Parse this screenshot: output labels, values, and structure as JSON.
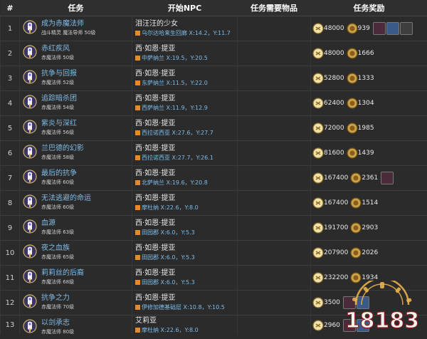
{
  "header": {
    "num": "#",
    "quest": "任务",
    "npc": "开始NPC",
    "items": "任务需要物品",
    "rewards": "任务奖励"
  },
  "rows": [
    {
      "n": "1",
      "name": "成为赤魔法师",
      "sub": "战斗精灵 魔法导师 50级",
      "npc": "泪汪汪的少女",
      "loc": "乌尔达哈来生回廊 X:14.2，Y:11.7",
      "gil": "48000",
      "seals": "939",
      "items": 3
    },
    {
      "n": "2",
      "name": "赤红疾风",
      "sub": "赤魔法师 50级",
      "npc": "西·如恩·提亚",
      "loc": "中萨纳兰 X:19.5，Y:20.5",
      "gil": "48000",
      "seals": "1666",
      "items": 0
    },
    {
      "n": "3",
      "name": "抗争与回报",
      "sub": "赤魔法师 52级",
      "npc": "西·如恩·提亚",
      "loc": "东萨纳兰 X:11.5，Y:22.0",
      "gil": "52800",
      "seals": "1333",
      "items": 0
    },
    {
      "n": "4",
      "name": "追踪暗杀团",
      "sub": "赤魔法师 54级",
      "npc": "西·如恩·提亚",
      "loc": "西萨纳兰 X:11.9，Y:12.9",
      "gil": "62400",
      "seals": "1304",
      "items": 0
    },
    {
      "n": "5",
      "name": "紫炎与深红",
      "sub": "赤魔法师 56级",
      "npc": "西·如恩·提亚",
      "loc": "西拉诺西亚 X:27.6，Y:27.7",
      "gil": "72000",
      "seals": "1985",
      "items": 0
    },
    {
      "n": "6",
      "name": "兰巴德的幻影",
      "sub": "赤魔法师 58级",
      "npc": "西·如恩·提亚",
      "loc": "西拉诺西亚 X:27.7，Y:26.1",
      "gil": "81600",
      "seals": "1439",
      "items": 0
    },
    {
      "n": "7",
      "name": "最后的抗争",
      "sub": "赤魔法师 60级",
      "npc": "西·如恩·提亚",
      "loc": "北萨纳兰 X:19.6，Y:20.8",
      "gil": "167400",
      "seals": "2361",
      "items": 1
    },
    {
      "n": "8",
      "name": "无法逃避的命运",
      "sub": "赤魔法师 60级",
      "npc": "西·如恩·提亚",
      "loc": "摩杜纳 X:22.6，Y:8.0",
      "gil": "167400",
      "seals": "1514",
      "items": 0
    },
    {
      "n": "9",
      "name": "血源",
      "sub": "赤魔法师 63级",
      "npc": "西·如恩·提亚",
      "loc": "田园郡 X:6.0，Y:5.3",
      "gil": "191700",
      "seals": "2903",
      "items": 0
    },
    {
      "n": "10",
      "name": "夜之血族",
      "sub": "赤魔法师 65级",
      "npc": "西·如恩·提亚",
      "loc": "田园郡 X:6.0，Y:5.3",
      "gil": "207900",
      "seals": "2026",
      "items": 0
    },
    {
      "n": "11",
      "name": "莉莉丝的后裔",
      "sub": "赤魔法师 68级",
      "npc": "西·如恩·提亚",
      "loc": "田园郡 X:6.0，Y:5.3",
      "gil": "232200",
      "seals": "1934",
      "items": 0
    },
    {
      "n": "12",
      "name": "抗争之力",
      "sub": "赤魔法师 70级",
      "npc": "西·如恩·提亚",
      "loc": "伊修加德基础层 X:10.8，Y:10.5",
      "gil": "3500",
      "seals": "",
      "items": 2
    },
    {
      "n": "13",
      "name": "以剑承志",
      "sub": "赤魔法师 80级",
      "npc": "艾莉亚",
      "loc": "摩杜纳 X:22.6，Y:8.0",
      "gil": "2960",
      "seals": "",
      "items": 2
    }
  ],
  "watermark": "18183",
  "colors": {
    "link": "#7fbce8",
    "marker": "#e58a2b",
    "bg": "#2b2b2b"
  }
}
